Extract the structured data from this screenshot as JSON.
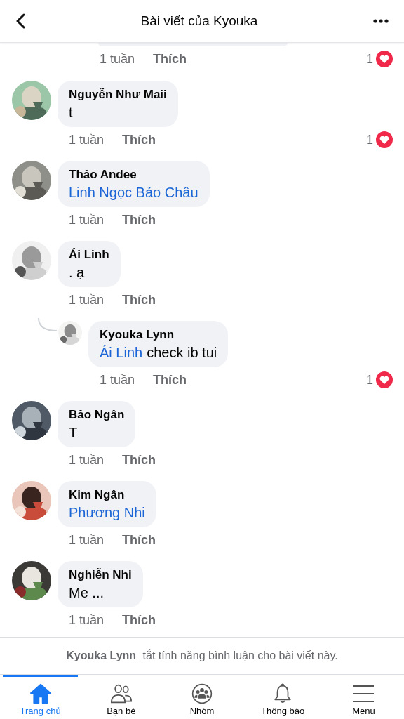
{
  "header": {
    "title": "Bài viết của Kyouka"
  },
  "comments": [
    {
      "kind": "tail",
      "time": "1 tuần",
      "like": "Thích",
      "reactions": "1"
    },
    {
      "kind": "comment",
      "name": "Nguyễn Như Maii",
      "text": "t",
      "time": "1 tuần",
      "like": "Thích",
      "reactions": "1"
    },
    {
      "kind": "comment",
      "name": "Thảo Andee",
      "mention": "Linh Ngọc Bảo Châu",
      "time": "1 tuần",
      "like": "Thích"
    },
    {
      "kind": "comment",
      "name": "Ái Linh",
      "text": ". ạ",
      "time": "1 tuần",
      "like": "Thích"
    },
    {
      "kind": "reply",
      "name": "Kyouka Lynn",
      "mention": "Ái Linh",
      "text": "check ib tui",
      "time": "1 tuần",
      "like": "Thích",
      "reactions": "1"
    },
    {
      "kind": "comment",
      "name": "Bảo Ngân",
      "text": "T",
      "time": "1 tuần",
      "like": "Thích"
    },
    {
      "kind": "comment",
      "name": "Kim Ngân",
      "mention": "Phương Nhi",
      "time": "1 tuần",
      "like": "Thích"
    },
    {
      "kind": "comment",
      "name": "Nghiễn Nhi",
      "text": "Me ...",
      "time": "1 tuần",
      "like": "Thích"
    }
  ],
  "notice": "**Kyouka Lynn** tắt tính năng bình luận cho bài viết này.",
  "tabs": [
    {
      "kind": "home",
      "label": "Trang chủ",
      "selected": true
    },
    {
      "kind": "friends",
      "label": "Bạn bè",
      "selected": false
    },
    {
      "kind": "groups",
      "label": "Nhóm",
      "selected": false
    },
    {
      "kind": "bell",
      "label": "Thông báo",
      "selected": false
    },
    {
      "kind": "menu",
      "label": "Menu",
      "selected": false
    }
  ]
}
